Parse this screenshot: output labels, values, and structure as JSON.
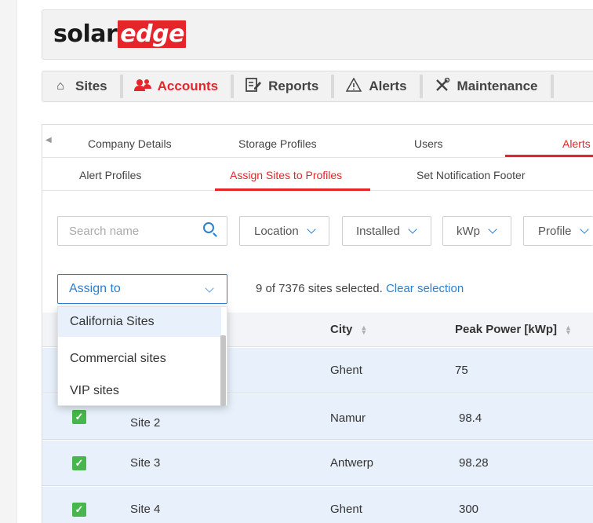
{
  "brand": {
    "logo_dark": "solar",
    "logo_highlight": "edge",
    "accent_color": "#e4262b"
  },
  "nav": [
    {
      "icon": "home-icon",
      "label": "Sites"
    },
    {
      "icon": "users-icon",
      "label": "Accounts",
      "active": true
    },
    {
      "icon": "reports-icon",
      "label": "Reports"
    },
    {
      "icon": "warning-icon",
      "label": "Alerts"
    },
    {
      "icon": "tools-icon",
      "label": "Maintenance"
    }
  ],
  "tabs": [
    "Company Details",
    "Storage Profiles",
    "Users",
    "Alerts"
  ],
  "subtabs": [
    "Alert Profiles",
    "Assign Sites to Profiles",
    "Set Notification Footer"
  ],
  "filters": {
    "search_placeholder": "Search name",
    "location": "Location",
    "installed": "Installed",
    "kwp": "kWp",
    "profile": "Profile"
  },
  "assign": {
    "label": "Assign to"
  },
  "selection": {
    "text": "9 of 7376 sites selected.",
    "clear_label": "Clear selection"
  },
  "dropdown_options": [
    "California Sites",
    "Commercial sites",
    "VIP sites"
  ],
  "table": {
    "columns": {
      "city": "City",
      "peak_power": "Peak Power [kWp]"
    },
    "rows": [
      {
        "name": "",
        "city": "Ghent",
        "peak": "75"
      },
      {
        "name": "Site 2",
        "city": "Namur",
        "peak": "98.4"
      },
      {
        "name": "Site 3",
        "city": "Antwerp",
        "peak": "98.28"
      },
      {
        "name": "Site 4",
        "city": "Ghent",
        "peak": "300"
      }
    ]
  }
}
